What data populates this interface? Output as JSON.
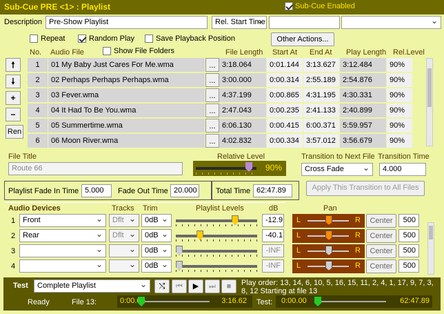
{
  "title": "Sub-Cue PRE <1> : Playlist",
  "subcue_enabled_label": "Sub-Cue Enabled",
  "description_label": "Description",
  "description_value": "Pre-Show Playlist",
  "rel_start": "Rel. Start Time",
  "options": {
    "repeat": "Repeat",
    "random": "Random Play",
    "save_pos": "Save Playback Position",
    "other": "Other Actions..."
  },
  "columns": {
    "no": "No.",
    "file": "Audio File",
    "show_folders": "Show File Folders",
    "length": "File Length",
    "start": "Start At",
    "end": "End At",
    "play": "Play Length",
    "rel": "Rel.Level"
  },
  "rows": [
    {
      "no": "1",
      "file": "01 My Baby Just Cares For Me.wma",
      "length": "3:18.064",
      "start": "0:01.144",
      "end": "3:13.627",
      "play": "3:12.484",
      "rel": "90%"
    },
    {
      "no": "2",
      "file": "02 Perhaps Perhaps Perhaps.wma",
      "length": "3:00.000",
      "start": "0:00.314",
      "end": "2:55.189",
      "play": "2:54.876",
      "rel": "90%"
    },
    {
      "no": "3",
      "file": "03 Fever.wma",
      "length": "4:37.199",
      "start": "0:00.865",
      "end": "4:31.195",
      "play": "4:30.331",
      "rel": "90%"
    },
    {
      "no": "4",
      "file": "04 It Had To Be You.wma",
      "length": "2:47.043",
      "start": "0:00.235",
      "end": "2:41.133",
      "play": "2:40.899",
      "rel": "90%"
    },
    {
      "no": "5",
      "file": "05 Summertime.wma",
      "length": "6:06.130",
      "start": "0:00.415",
      "end": "6:00.371",
      "play": "5:59.957",
      "rel": "90%"
    },
    {
      "no": "6",
      "file": "06 Moon River.wma",
      "length": "4:02.832",
      "start": "0:00.334",
      "end": "3:57.012",
      "play": "3:56.679",
      "rel": "90%"
    }
  ],
  "nav": {
    "up": "🠕",
    "down": "🠗",
    "add": "+",
    "remove": "−",
    "ren": "Ren"
  },
  "file_title_label": "File Title",
  "file_title_value": "Route 66",
  "relative_level_label": "Relative Level",
  "relative_level_value": "90%",
  "transition_label": "Transition to Next File",
  "transition_value": "Cross Fade",
  "transition_time_label": "Transition Time",
  "transition_time_value": "4.000",
  "fade_in_label": "Playlist Fade In Time",
  "fade_in_value": "5.000",
  "fade_out_label": "Fade Out Time",
  "fade_out_value": "20.000",
  "total_time_label": "Total Time",
  "total_time_value": "62:47.89",
  "apply_all": "Apply This Transition to All Files",
  "audio": {
    "title": "Audio Devices",
    "tracks": "Tracks",
    "trim": "Trim",
    "levels": "Playlist Levels",
    "db": "dB",
    "pan": "Pan",
    "rows": [
      {
        "n": "1",
        "device": "Front",
        "tracks": "Dflt",
        "trim": "0dB",
        "db": "-12.9",
        "pan_l": "L",
        "pan_r": "R",
        "center": "Center",
        "pan_val": "500",
        "level": 0.75,
        "color": "#ffcc00",
        "pancolor": "#ff8a00"
      },
      {
        "n": "2",
        "device": "Rear",
        "tracks": "Dflt",
        "trim": "0dB",
        "db": "-40.1",
        "pan_l": "L",
        "pan_r": "R",
        "center": "Center",
        "pan_val": "500",
        "level": 0.28,
        "color": "#ffcc00",
        "pancolor": "#ff8a00"
      },
      {
        "n": "3",
        "device": "",
        "tracks": "",
        "trim": "0dB",
        "db": "-INF",
        "pan_l": "L",
        "pan_r": "R",
        "center": "Center",
        "pan_val": "500",
        "level": 0.0,
        "color": "#cfcfcf",
        "pancolor": "#cfcfcf"
      },
      {
        "n": "4",
        "device": "",
        "tracks": "",
        "trim": "0dB",
        "db": "-INF",
        "pan_l": "L",
        "pan_r": "R",
        "center": "Center",
        "pan_val": "500",
        "level": 0.0,
        "color": "#cfcfcf",
        "pancolor": "#cfcfcf"
      }
    ]
  },
  "test": {
    "label": "Test",
    "mode": "Complete Playlist",
    "play_order": "Play order: 13, 14, 6, 10, 5, 16, 15, 11, 2, 4, 1, 17, 9, 7, 3, 8, 12 Starting at file 13",
    "status": "Ready",
    "file_label": "File 13:",
    "file_start": "0:00.00",
    "file_end": "3:16.62",
    "test_label": "Test:",
    "test_start": "0:00.00",
    "test_end": "62:47.89",
    "file_progress": 0.0,
    "test_progress": 0.0
  }
}
